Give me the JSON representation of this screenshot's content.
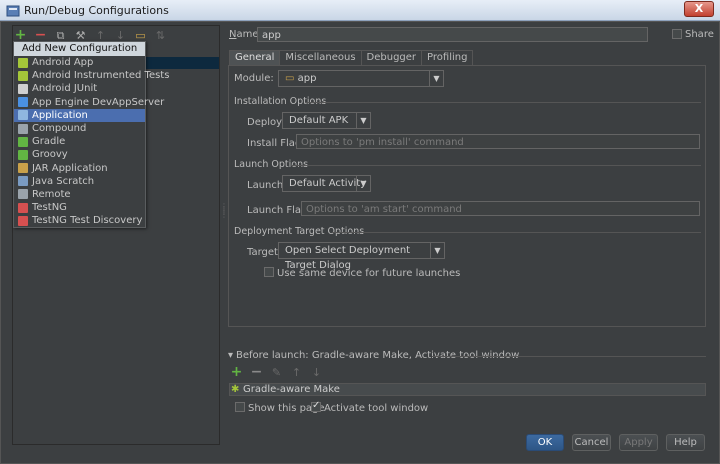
{
  "window": {
    "title": "Run/Debug Configurations",
    "close_label": "X"
  },
  "popup": {
    "header": "Add New Configuration",
    "items": [
      {
        "label": "Android App",
        "icon": "android-app-icon",
        "color": "#a4c639"
      },
      {
        "label": "Android Instrumented Tests",
        "icon": "android-tests-icon",
        "color": "#a4c639"
      },
      {
        "label": "Android JUnit",
        "icon": "junit-icon",
        "color": "#cfcfcf"
      },
      {
        "label": "App Engine DevAppServer",
        "icon": "app-engine-icon",
        "color": "#4a90e2"
      },
      {
        "label": "Application",
        "icon": "application-icon",
        "color": "#8fb7e0"
      },
      {
        "label": "Compound",
        "icon": "compound-icon",
        "color": "#9aa3ab"
      },
      {
        "label": "Gradle",
        "icon": "gradle-icon",
        "color": "#62b543"
      },
      {
        "label": "Groovy",
        "icon": "groovy-icon",
        "color": "#62b543"
      },
      {
        "label": "JAR Application",
        "icon": "jar-icon",
        "color": "#c9a14a"
      },
      {
        "label": "Java Scratch",
        "icon": "java-scratch-icon",
        "color": "#7a9bc2"
      },
      {
        "label": "Remote",
        "icon": "remote-icon",
        "color": "#9aa3ab"
      },
      {
        "label": "TestNG",
        "icon": "testng-icon",
        "color": "#d65050"
      },
      {
        "label": "TestNG Test Discovery",
        "icon": "testng-discovery-icon",
        "color": "#d65050"
      }
    ],
    "selected_index": 4
  },
  "name_label": "Name:",
  "name_value": "app",
  "share_label": "Share",
  "tabs": [
    "General",
    "Miscellaneous",
    "Debugger",
    "Profiling"
  ],
  "module_label": "Module:",
  "module_value": "app",
  "install": {
    "section": "Installation Options",
    "deploy_label": "Deploy:",
    "deploy_value": "Default APK",
    "flags_label": "Install Flags:",
    "flags_placeholder": "Options to 'pm install' command"
  },
  "launch": {
    "section": "Launch Options",
    "launch_label": "Launch:",
    "launch_value": "Default Activity",
    "flags_label": "Launch Flags:",
    "flags_placeholder": "Options to 'am start' command"
  },
  "deployment": {
    "section": "Deployment Target Options",
    "target_label": "Target:",
    "target_value": "Open Select Deployment Target Dialog",
    "same_device_label": "Use same device for future launches"
  },
  "before_launch": {
    "title": "Before launch: Gradle-aware Make, Activate tool window",
    "task": "Gradle-aware Make",
    "show_page_label": "Show this page",
    "activate_label": "Activate tool window"
  },
  "buttons": {
    "ok": "OK",
    "cancel": "Cancel",
    "apply": "Apply",
    "help": "Help"
  },
  "colors": {
    "accent": "#4b6eaf",
    "background": "#3c3f41"
  }
}
